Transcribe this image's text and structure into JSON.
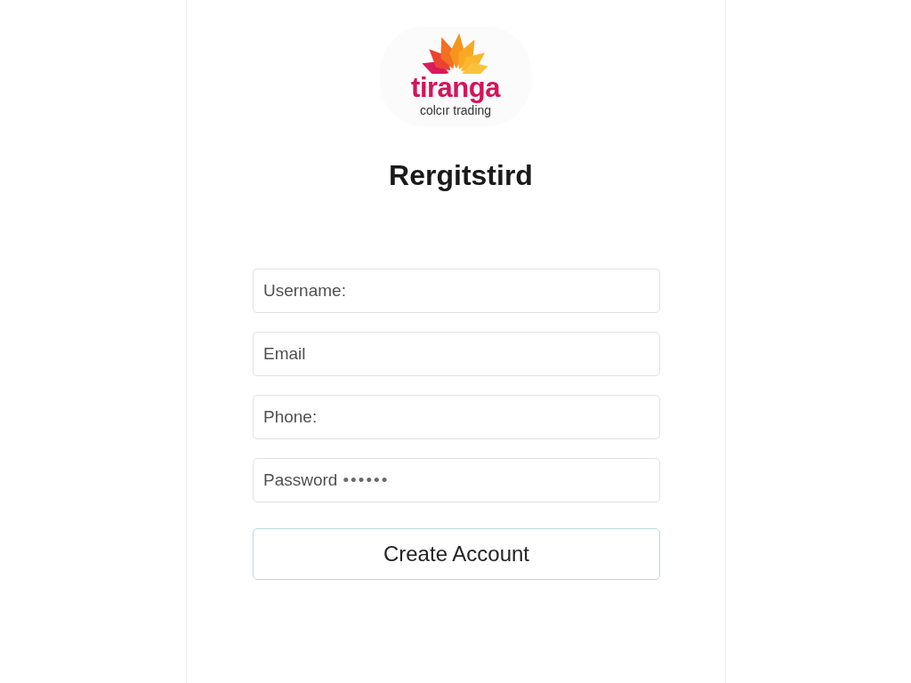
{
  "logo": {
    "name": "tiranga",
    "tagline": "colcır trading"
  },
  "title": "Rergitstird",
  "fields": [
    {
      "kind": "text",
      "placeholder": "Username:"
    },
    {
      "kind": "text",
      "placeholder": "Email"
    },
    {
      "kind": "text",
      "placeholder": "Phone:"
    },
    {
      "kind": "password",
      "label": "Password",
      "value": "••••••"
    }
  ],
  "submit_button": "Create Account"
}
